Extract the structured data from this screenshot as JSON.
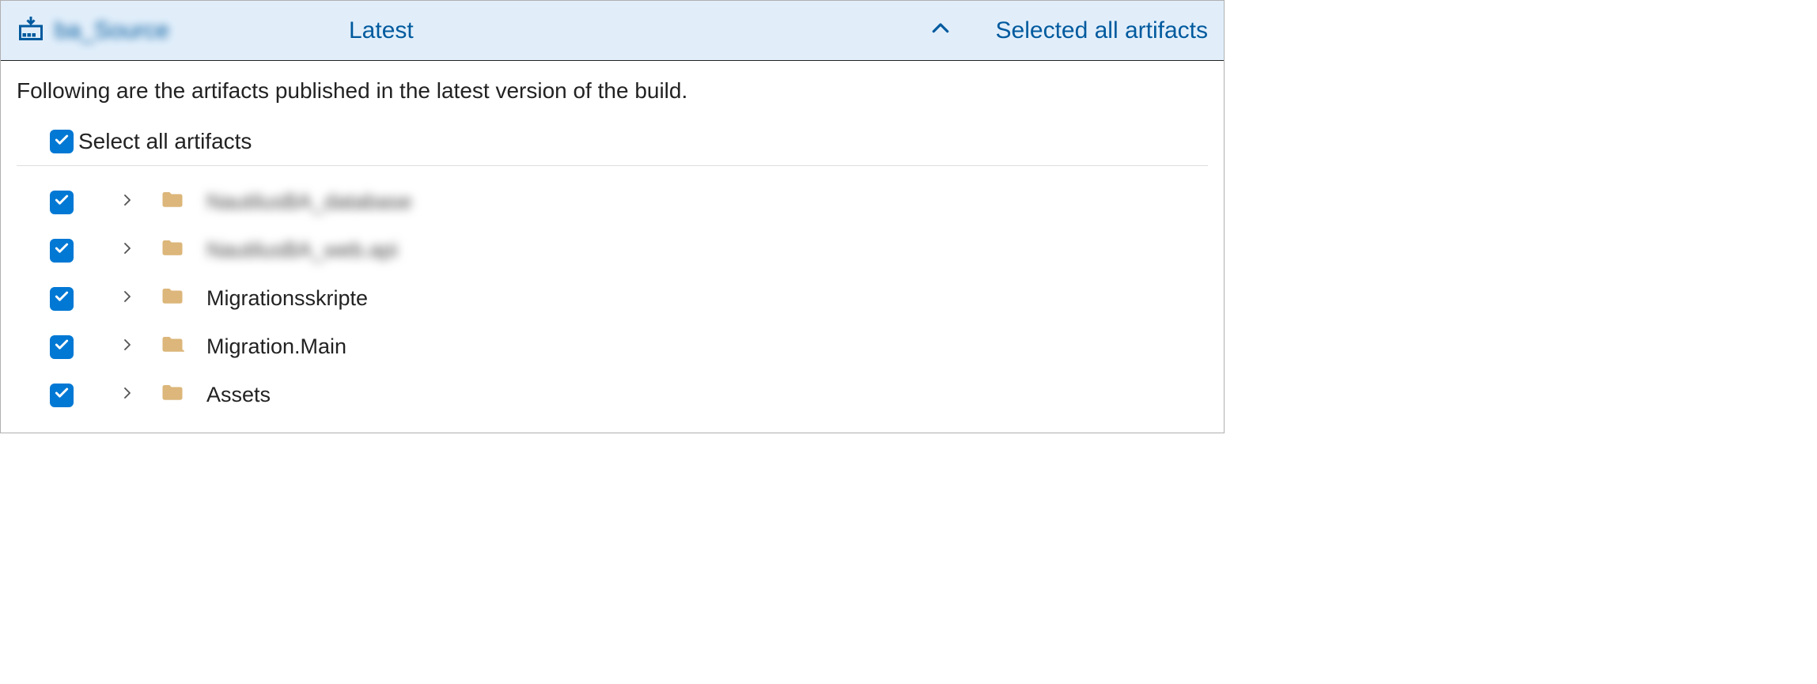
{
  "header": {
    "source_name": "ba_Source",
    "version_label": "Latest",
    "status_label": "Selected all artifacts"
  },
  "description": "Following are the artifacts published in the latest version of the build.",
  "select_all_label": "Select all artifacts",
  "folders": [
    {
      "name": "NautilusBA_database",
      "blurred": true
    },
    {
      "name": "NautilusBA_web.api",
      "blurred": true
    },
    {
      "name": "Migrationsskripte",
      "blurred": false
    },
    {
      "name": "Migration.Main",
      "blurred": false
    },
    {
      "name": "Assets",
      "blurred": false
    }
  ]
}
